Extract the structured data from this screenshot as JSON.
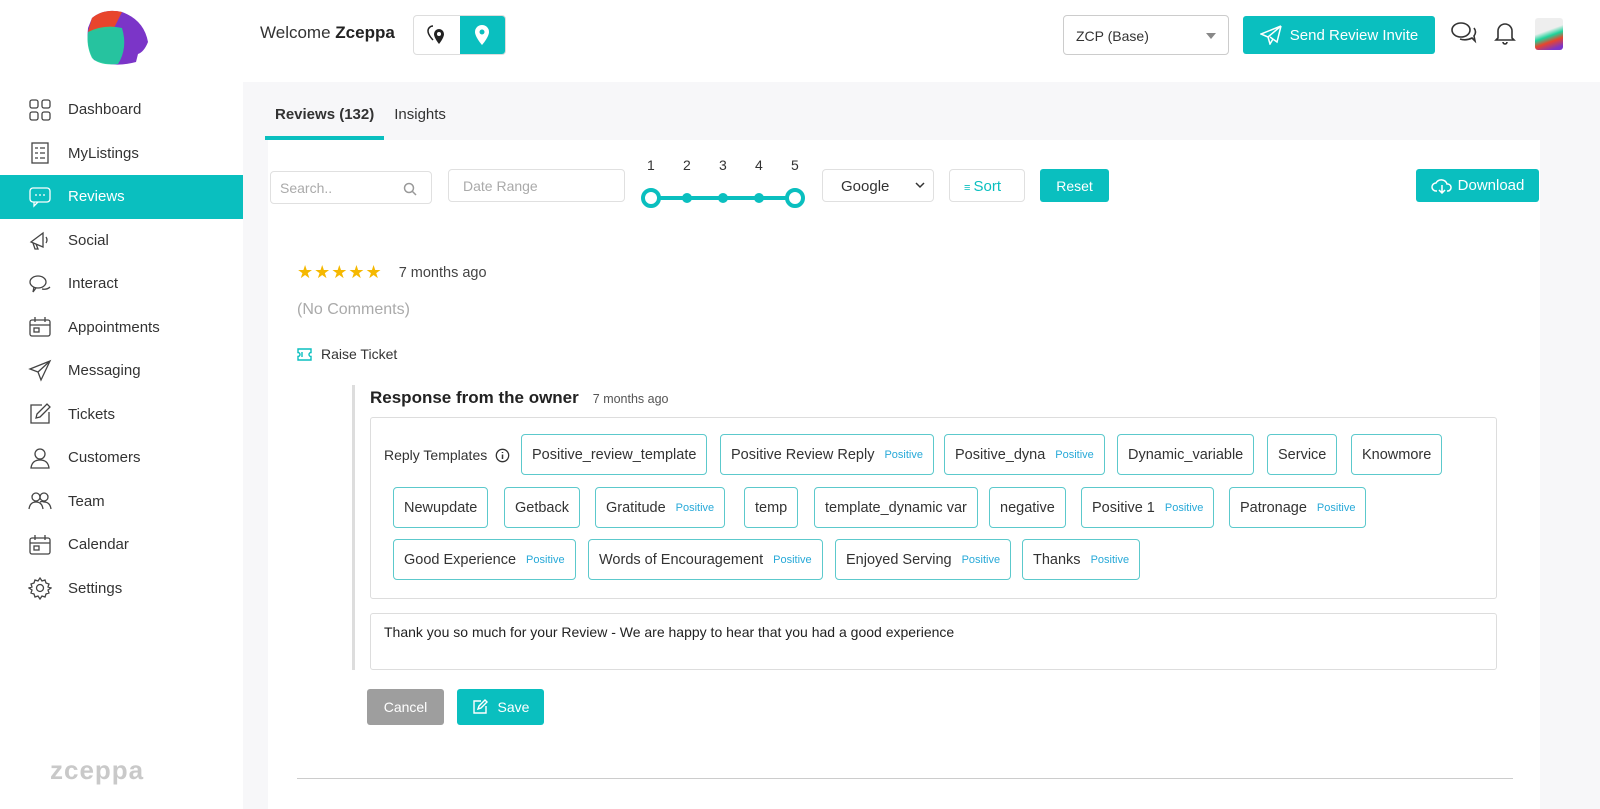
{
  "sidebar": {
    "brand": "zceppa",
    "items": [
      {
        "label": "Dashboard",
        "icon": "grid-icon"
      },
      {
        "label": "MyListings",
        "icon": "list-icon"
      },
      {
        "label": "Reviews",
        "icon": "chat-icon",
        "active": true
      },
      {
        "label": "Social",
        "icon": "megaphone-icon"
      },
      {
        "label": "Interact",
        "icon": "chat-bubbles-icon"
      },
      {
        "label": "Appointments",
        "icon": "calendar-icon"
      },
      {
        "label": "Messaging",
        "icon": "paper-plane-icon"
      },
      {
        "label": "Tickets",
        "icon": "edit-icon"
      },
      {
        "label": "Customers",
        "icon": "user-icon"
      },
      {
        "label": "Team",
        "icon": "team-icon"
      },
      {
        "label": "Calendar",
        "icon": "calendar-icon"
      },
      {
        "label": "Settings",
        "icon": "gear-icon"
      }
    ]
  },
  "header": {
    "welcome": "Welcome",
    "user": "Zceppa",
    "location_select": "ZCP (Base)",
    "send_invite": "Send Review Invite"
  },
  "tabs": [
    {
      "label": "Reviews (132)",
      "active": true
    },
    {
      "label": "Insights"
    }
  ],
  "filters": {
    "search_placeholder": "Search..",
    "date_placeholder": "Date Range",
    "rating_labels": [
      "1",
      "2",
      "3",
      "4",
      "5"
    ],
    "rating_range": [
      1,
      5
    ],
    "source": "Google",
    "sort": "Sort",
    "reset": "Reset",
    "download": "Download"
  },
  "review": {
    "stars": 5,
    "time": "7 months ago",
    "comment": "(No Comments)",
    "raise_ticket": "Raise Ticket"
  },
  "response": {
    "title": "Response from the owner",
    "time": "7 months ago",
    "templates_label": "Reply Templates",
    "templates": [
      {
        "name": "Positive_review_template"
      },
      {
        "name": "Positive Review Reply",
        "tag": "Positive"
      },
      {
        "name": "Positive_dyna",
        "tag": "Positive"
      },
      {
        "name": "Dynamic_variable"
      },
      {
        "name": "Service"
      },
      {
        "name": "Knowmore"
      },
      {
        "name": "Newupdate"
      },
      {
        "name": "Getback"
      },
      {
        "name": "Gratitude",
        "tag": "Positive"
      },
      {
        "name": "temp"
      },
      {
        "name": "template_dynamic var"
      },
      {
        "name": "negative"
      },
      {
        "name": "Positive 1",
        "tag": "Positive"
      },
      {
        "name": "Patronage",
        "tag": "Positive"
      },
      {
        "name": "Good Experience",
        "tag": "Positive"
      },
      {
        "name": "Words of Encouragement",
        "tag": "Positive"
      },
      {
        "name": "Enjoyed Serving",
        "tag": "Positive"
      },
      {
        "name": "Thanks",
        "tag": "Positive"
      }
    ],
    "text": "Thank you so much for your Review - We are happy to hear that you had a good experience",
    "cancel": "Cancel",
    "save": "Save"
  },
  "colors": {
    "accent": "#0abfbf",
    "star": "#f5b800",
    "tag": "#27a9d8"
  }
}
